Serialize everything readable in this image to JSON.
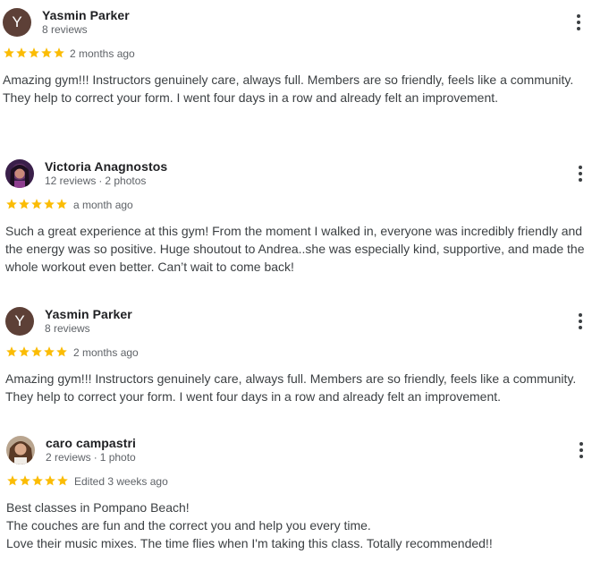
{
  "colors": {
    "star": "#fbbc04",
    "avatar_letter_bg": "#5d4037",
    "text_primary": "#202124",
    "text_secondary": "#5f6368"
  },
  "reviews": [
    {
      "author": "Yasmin Parker",
      "avatar_letter": "Y",
      "stats": [
        "8 reviews"
      ],
      "rating": 5,
      "date": "2 months ago",
      "text": "Amazing gym!!! Instructors genuinely care, always full. Members are so friendly, feels like a community.\nThey help to correct your form. I went four days in a row and already felt an improvement.",
      "more_icon": "more-vert-icon"
    },
    {
      "author": "Victoria Anagnostos",
      "avatar_icon": "profile-photo-avatar",
      "stats": [
        "12 reviews",
        "2 photos"
      ],
      "rating": 5,
      "date": "a month ago",
      "text": "Such a great experience at this gym! From the moment I walked in, everyone was incredibly friendly and\nthe energy was so positive. Huge shoutout to Andrea..she was especially kind, supportive, and made the\nwhole workout even better. Can’t wait to come back!",
      "more_icon": "more-vert-icon"
    },
    {
      "author": "Yasmin Parker",
      "avatar_letter": "Y",
      "stats": [
        "8 reviews"
      ],
      "rating": 5,
      "date": "2 months ago",
      "text": "Amazing gym!!! Instructors genuinely care, always full. Members are so friendly, feels like a community.\nThey help to correct your form. I went four days in a row and already felt an improvement.",
      "more_icon": "more-vert-icon"
    },
    {
      "author": "caro campastri",
      "avatar_icon": "profile-photo-avatar",
      "stats": [
        "2 reviews",
        "1 photo"
      ],
      "rating": 5,
      "date": "Edited 3 weeks ago",
      "text": "Best classes in Pompano Beach!\nThe couches are fun and the correct you and help you every time.\nLove their music mixes. The time flies when I'm taking this class. Totally recommended!!",
      "more_icon": "more-vert-icon"
    }
  ]
}
